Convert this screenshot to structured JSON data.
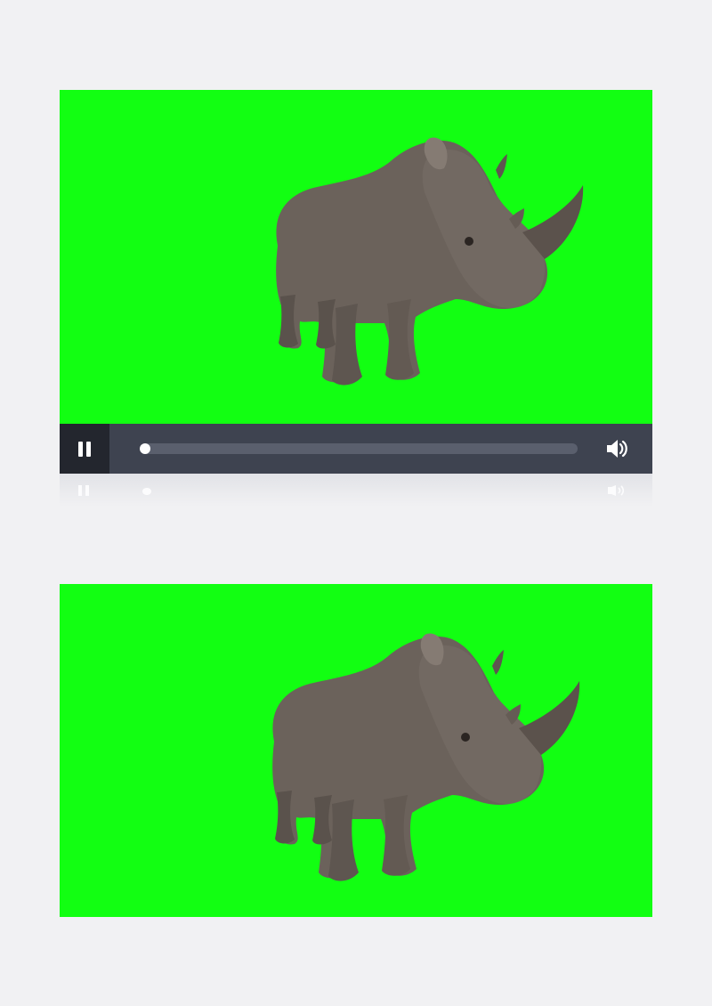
{
  "player": {
    "state": "playing",
    "progress": 0.0,
    "controls": {
      "pause_icon": "pause-icon",
      "volume_icon": "volume-icon"
    }
  },
  "preview": {
    "content": "rhino-green-screen"
  },
  "colors": {
    "green_screen": "#12ff12",
    "control_bar": "#3e4350",
    "pause_button_bg": "#23262e",
    "progress_track": "#5a5f6d",
    "page_bg": "#f1f1f3"
  }
}
